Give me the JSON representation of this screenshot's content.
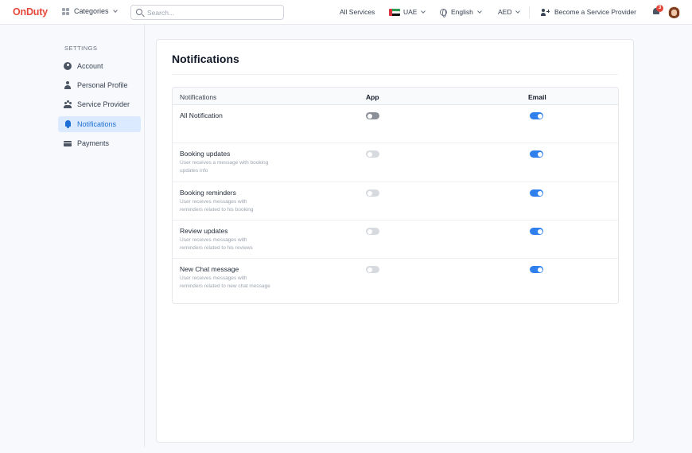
{
  "header": {
    "logo": "OnDuty",
    "categories_label": "Categories",
    "search_placeholder": "Search...",
    "all_services": "All Services",
    "country": "UAE",
    "language": "English",
    "currency": "AED",
    "become_provider": "Become a Service Provider",
    "notification_count": "3"
  },
  "sidebar": {
    "heading": "SETTINGS",
    "items": [
      {
        "label": "Account",
        "icon": "account-circle-icon"
      },
      {
        "label": "Personal Profile",
        "icon": "person-icon"
      },
      {
        "label": "Service Provider",
        "icon": "group-icon"
      },
      {
        "label": "Notifications",
        "icon": "bell-icon",
        "active": true
      },
      {
        "label": "Payments",
        "icon": "credit-card-icon"
      }
    ]
  },
  "main": {
    "title": "Notifications",
    "columns": [
      "Notifications",
      "App",
      "Email"
    ],
    "rows": [
      {
        "title": "All Notification",
        "desc": "",
        "app": false,
        "email": true
      },
      {
        "title": "Booking updates",
        "desc": "User receives a message with booking updates info",
        "app": false,
        "email": true
      },
      {
        "title": "Booking reminders",
        "desc": "User receives messages with reminders related to his booking",
        "app": false,
        "email": true
      },
      {
        "title": "Review updates",
        "desc": "User receives messages with reminders related to his reviews",
        "app": false,
        "email": true
      },
      {
        "title": "New Chat message",
        "desc": "User receives messages with reminders related to new chat message",
        "app": false,
        "email": true
      }
    ]
  },
  "colors": {
    "brand": "#e5483b",
    "accent": "#2f80ed",
    "active_nav_bg": "#dbeafe"
  }
}
